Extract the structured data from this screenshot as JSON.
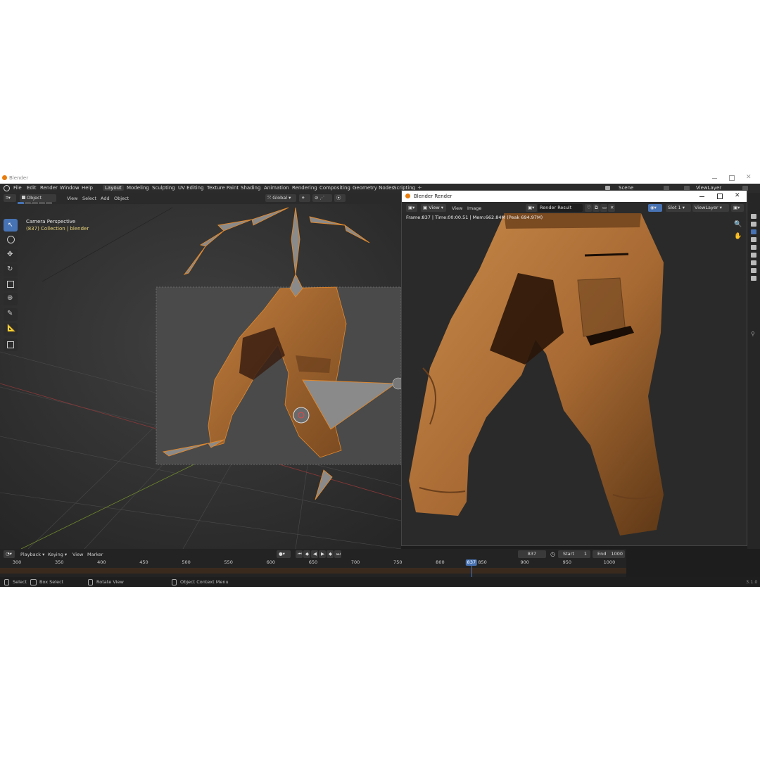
{
  "app": {
    "title": "Blender",
    "version": "3.1.0"
  },
  "menu": {
    "file": "File",
    "edit": "Edit",
    "render": "Render",
    "window": "Window",
    "help": "Help"
  },
  "workspaces": [
    {
      "label": "Layout",
      "active": true
    },
    {
      "label": "Modeling"
    },
    {
      "label": "Sculpting"
    },
    {
      "label": "UV Editing"
    },
    {
      "label": "Texture Paint"
    },
    {
      "label": "Shading"
    },
    {
      "label": "Animation"
    },
    {
      "label": "Rendering"
    },
    {
      "label": "Compositing"
    },
    {
      "label": "Geometry Nodes"
    },
    {
      "label": "Scripting"
    }
  ],
  "topright": {
    "scene": "Scene",
    "view_layer": "ViewLayer"
  },
  "viewport_header": {
    "mode": "Object Mode",
    "view": "View",
    "select": "Select",
    "add": "Add",
    "object": "Object",
    "orientation": "Global"
  },
  "viewport": {
    "camera_label": "Camera Perspective",
    "collection_label": "(837) Collection | blender"
  },
  "render_window": {
    "title": "Blender Render",
    "view1": "View",
    "view2": "View",
    "image": "Image",
    "image_name": "Render Result",
    "slot": "Slot 1",
    "view_layer": "ViewLayer",
    "stats": "Frame:837 | Time:00:00.51 | Mem:662.84M (Peak 694.97M)"
  },
  "timeline": {
    "playback": "Playback",
    "keying": "Keying",
    "view": "View",
    "marker": "Marker",
    "current_frame": "837",
    "start_label": "Start",
    "start_value": "1",
    "end_label": "End",
    "end_value": "1000",
    "ticks": [
      "300",
      "350",
      "400",
      "450",
      "500",
      "550",
      "600",
      "650",
      "700",
      "750",
      "800",
      "850",
      "900",
      "950",
      "1000"
    ],
    "playhead_label": "837",
    "frame_start": 280,
    "frame_end": 1020,
    "playhead_frame": 837
  },
  "status": {
    "select": "Select",
    "box_select": "Box Select",
    "rotate_view": "Rotate View",
    "context_menu": "Object Context Menu"
  },
  "colors": {
    "accent": "#4772b3",
    "rig_orange": "#e2882b",
    "pants": "#a86a33"
  }
}
